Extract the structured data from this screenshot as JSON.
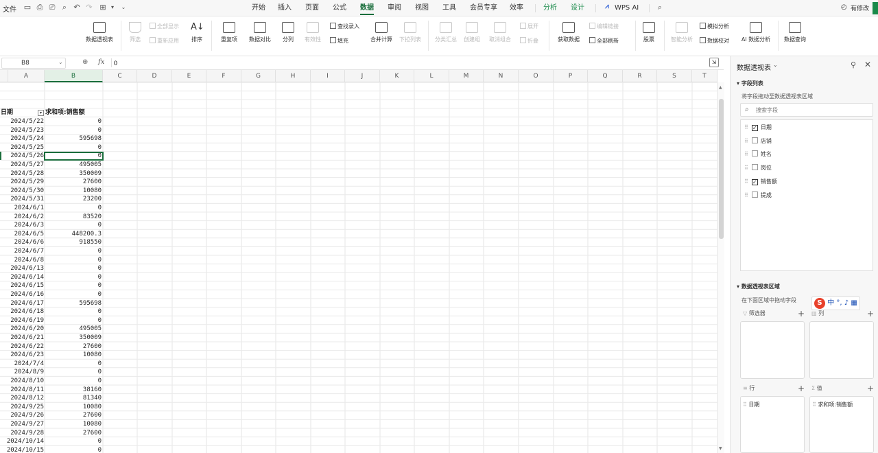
{
  "menubar": {
    "file_label": "文件",
    "tabs": [
      "开始",
      "插入",
      "页面",
      "公式",
      "数据",
      "审阅",
      "视图",
      "工具",
      "会员专享",
      "效率",
      "分析",
      "设计",
      "WPS AI"
    ],
    "active_tab": "数据",
    "modified_label": "有修改"
  },
  "ribbon": {
    "pivot_table": "数据透视表",
    "filter": "筛选",
    "show_all": "全部显示",
    "reapply": "重新应用",
    "sort": "排序",
    "duplicates": "重复项",
    "compare": "数据对比",
    "split": "分列",
    "validity": "有效性",
    "lookup_entry": "查找录入",
    "fill": "填充",
    "consolidate": "合并计算",
    "dropdown_list": "下拉列表",
    "subtotal": "分类汇总",
    "group": "创建组",
    "ungroup": "取消组合",
    "expand": "展开",
    "collapse": "折叠",
    "get_data": "获取数据",
    "edit_links": "编辑链接",
    "refresh_all": "全部刷新",
    "stocks": "股票",
    "smart_analysis": "智能分析",
    "what_if": "模拟分析",
    "data_check": "数据校对",
    "ai_analysis": "AI 数据分析",
    "data_query": "数据查询"
  },
  "formula_bar": {
    "name_box": "B8",
    "fx": "fx",
    "value": "0"
  },
  "grid": {
    "columns": [
      "A",
      "B",
      "C",
      "D",
      "E",
      "F",
      "G",
      "H",
      "I",
      "J",
      "K",
      "L",
      "M",
      "N",
      "O",
      "P",
      "Q",
      "R",
      "S",
      "T"
    ],
    "selected_column": "B",
    "header_date": "日期",
    "header_sum": "求和项:销售额",
    "rows": [
      [
        "2024/5/22",
        "0"
      ],
      [
        "2024/5/23",
        "0"
      ],
      [
        "2024/5/24",
        "595698"
      ],
      [
        "2024/5/25",
        "0"
      ],
      [
        "2024/5/26",
        "0"
      ],
      [
        "2024/5/27",
        "495005"
      ],
      [
        "2024/5/28",
        "350009"
      ],
      [
        "2024/5/29",
        "27600"
      ],
      [
        "2024/5/30",
        "10080"
      ],
      [
        "2024/5/31",
        "23200"
      ],
      [
        "2024/6/1",
        "0"
      ],
      [
        "2024/6/2",
        "83520"
      ],
      [
        "2024/6/3",
        "0"
      ],
      [
        "2024/6/5",
        "448200.3"
      ],
      [
        "2024/6/6",
        "918550"
      ],
      [
        "2024/6/7",
        "0"
      ],
      [
        "2024/6/8",
        "0"
      ],
      [
        "2024/6/13",
        "0"
      ],
      [
        "2024/6/14",
        "0"
      ],
      [
        "2024/6/15",
        "0"
      ],
      [
        "2024/6/16",
        "0"
      ],
      [
        "2024/6/17",
        "595698"
      ],
      [
        "2024/6/18",
        "0"
      ],
      [
        "2024/6/19",
        "0"
      ],
      [
        "2024/6/20",
        "495005"
      ],
      [
        "2024/6/21",
        "350009"
      ],
      [
        "2024/6/22",
        "27600"
      ],
      [
        "2024/6/23",
        "10080"
      ],
      [
        "2024/7/4",
        "0"
      ],
      [
        "2024/8/9",
        "0"
      ],
      [
        "2024/8/10",
        "0"
      ],
      [
        "2024/8/11",
        "38160"
      ],
      [
        "2024/8/12",
        "81340"
      ],
      [
        "2024/9/25",
        "10080"
      ],
      [
        "2024/9/26",
        "27600"
      ],
      [
        "2024/9/27",
        "10080"
      ],
      [
        "2024/9/28",
        "27600"
      ],
      [
        "2024/10/14",
        "0"
      ],
      [
        "2024/10/15",
        "0"
      ],
      [
        "2024/10/16",
        "0"
      ]
    ]
  },
  "pivot_panel": {
    "title": "数据透视表",
    "field_list_section": "字段列表",
    "field_hint": "将字段拖动至数据透视表区域",
    "search_placeholder": "搜索字段",
    "fields": [
      {
        "label": "日期",
        "checked": true
      },
      {
        "label": "店铺",
        "checked": false
      },
      {
        "label": "姓名",
        "checked": false
      },
      {
        "label": "岗位",
        "checked": false
      },
      {
        "label": "销售额",
        "checked": true
      },
      {
        "label": "提成",
        "checked": false
      }
    ],
    "area_section": "数据透视表区域",
    "area_hint": "在下面区域中拖动字段",
    "filter_zone": "筛选器",
    "column_zone": "列",
    "row_zone": "行",
    "value_zone": "值",
    "row_item": "日期",
    "value_item": "求和项:销售额",
    "ime_label": "中"
  }
}
